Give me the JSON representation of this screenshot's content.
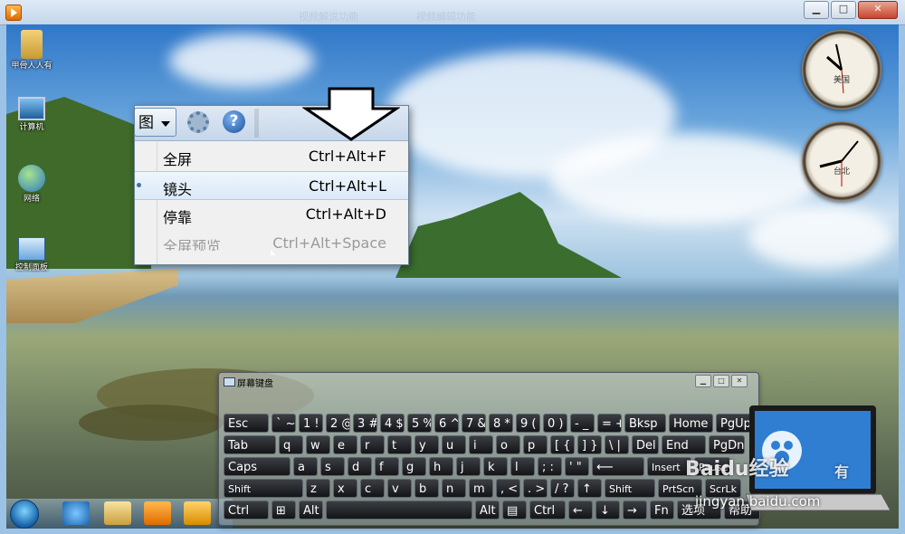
{
  "window": {
    "tab1": "视频解说功能",
    "tab2": "视频编辑功能",
    "minimize_glyph": "▁",
    "maximize_glyph": "□",
    "close_glyph": "✕"
  },
  "desktop_icons": [
    {
      "label": "甲骨人人有",
      "icon": "user-folder-icon"
    },
    {
      "label": "计算机",
      "icon": "computer-icon"
    },
    {
      "label": "网络",
      "icon": "network-icon"
    },
    {
      "label": "控制面板",
      "icon": "control-panel-icon"
    }
  ],
  "clocks": [
    {
      "city": "美国"
    },
    {
      "city": "台北"
    }
  ],
  "view_menu": {
    "button_label": "图",
    "items": [
      {
        "label": "全屏",
        "shortcut": "Ctrl+Alt+F"
      },
      {
        "label": "镜头",
        "shortcut": "Ctrl+Alt+L"
      },
      {
        "label": "停靠",
        "shortcut": "Ctrl+Alt+D"
      },
      {
        "label": "全屏预览",
        "shortcut": "Ctrl+Alt+Space"
      }
    ]
  },
  "keyboard": {
    "title": "屏幕键盘",
    "rows": [
      [
        "Esc",
        "` ~",
        "1 !",
        "2 @",
        "3 #",
        "4 $",
        "5 %",
        "6 ^",
        "7 &",
        "8 *",
        "9 (",
        "0 )",
        "- _",
        "= +",
        "Bksp",
        "Home",
        "PgUp"
      ],
      [
        "Tab",
        "q",
        "w",
        "e",
        "r",
        "t",
        "y",
        "u",
        "i",
        "o",
        "p",
        "[ {",
        "] }",
        "\\ |",
        "Del",
        "End",
        "PgDn"
      ],
      [
        "Caps",
        "a",
        "s",
        "d",
        "f",
        "g",
        "h",
        "j",
        "k",
        "l",
        "; :",
        "' \"",
        "⟵",
        "Insert",
        "Pause"
      ],
      [
        "Shift",
        "z",
        "x",
        "c",
        "v",
        "b",
        "n",
        "m",
        ", <",
        ". >",
        "/ ?",
        "↑",
        "Shift",
        "PrtScn",
        "ScrLk"
      ],
      [
        "Ctrl",
        "⊞",
        "Alt",
        "",
        "Alt",
        "▤",
        "Ctrl",
        "←",
        "↓",
        "→",
        "Fn",
        "选项",
        "帮助"
      ]
    ]
  },
  "watermark": {
    "brand": "Baidu经验",
    "url": "jingyan.baidu.com",
    "extra": "有"
  },
  "colors": {
    "titlebar": "#c3d6ea",
    "menu_hover": "#dbe9f8",
    "key_bg": "#1e2024"
  }
}
